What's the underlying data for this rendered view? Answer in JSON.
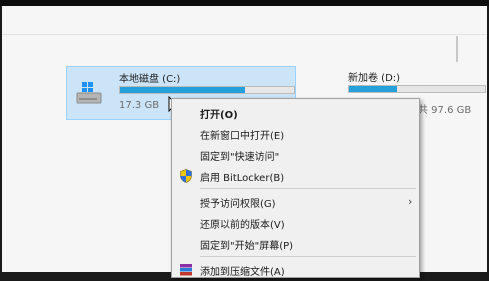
{
  "drives": {
    "c": {
      "name": "本地磁盘 (C:)",
      "size_text": "17.3 GB",
      "used_fraction": 0.72
    },
    "d": {
      "name": "新加卷 (D:)",
      "size_text": "共 97.6 GB",
      "used_fraction": 0.35
    }
  },
  "context_menu": {
    "items": [
      {
        "label": "打开(O)",
        "bold": true
      },
      {
        "label": "在新窗口中打开(E)"
      },
      {
        "label": "固定到\"快速访问\""
      },
      {
        "label": "启用 BitLocker(B)",
        "icon": "uac-shield-icon"
      },
      {
        "label": "授予访问权限(G)",
        "has_submenu": true
      },
      {
        "label": "还原以前的版本(V)"
      },
      {
        "label": "固定到\"开始\"屏幕(P)"
      },
      {
        "label": "添加到压缩文件(A)",
        "icon": "winrar-archive-icon"
      }
    ]
  },
  "colors": {
    "selection_bg": "#cce4f7",
    "progress_fill": "#26a0da",
    "menu_bg": "#f0f0f0"
  }
}
